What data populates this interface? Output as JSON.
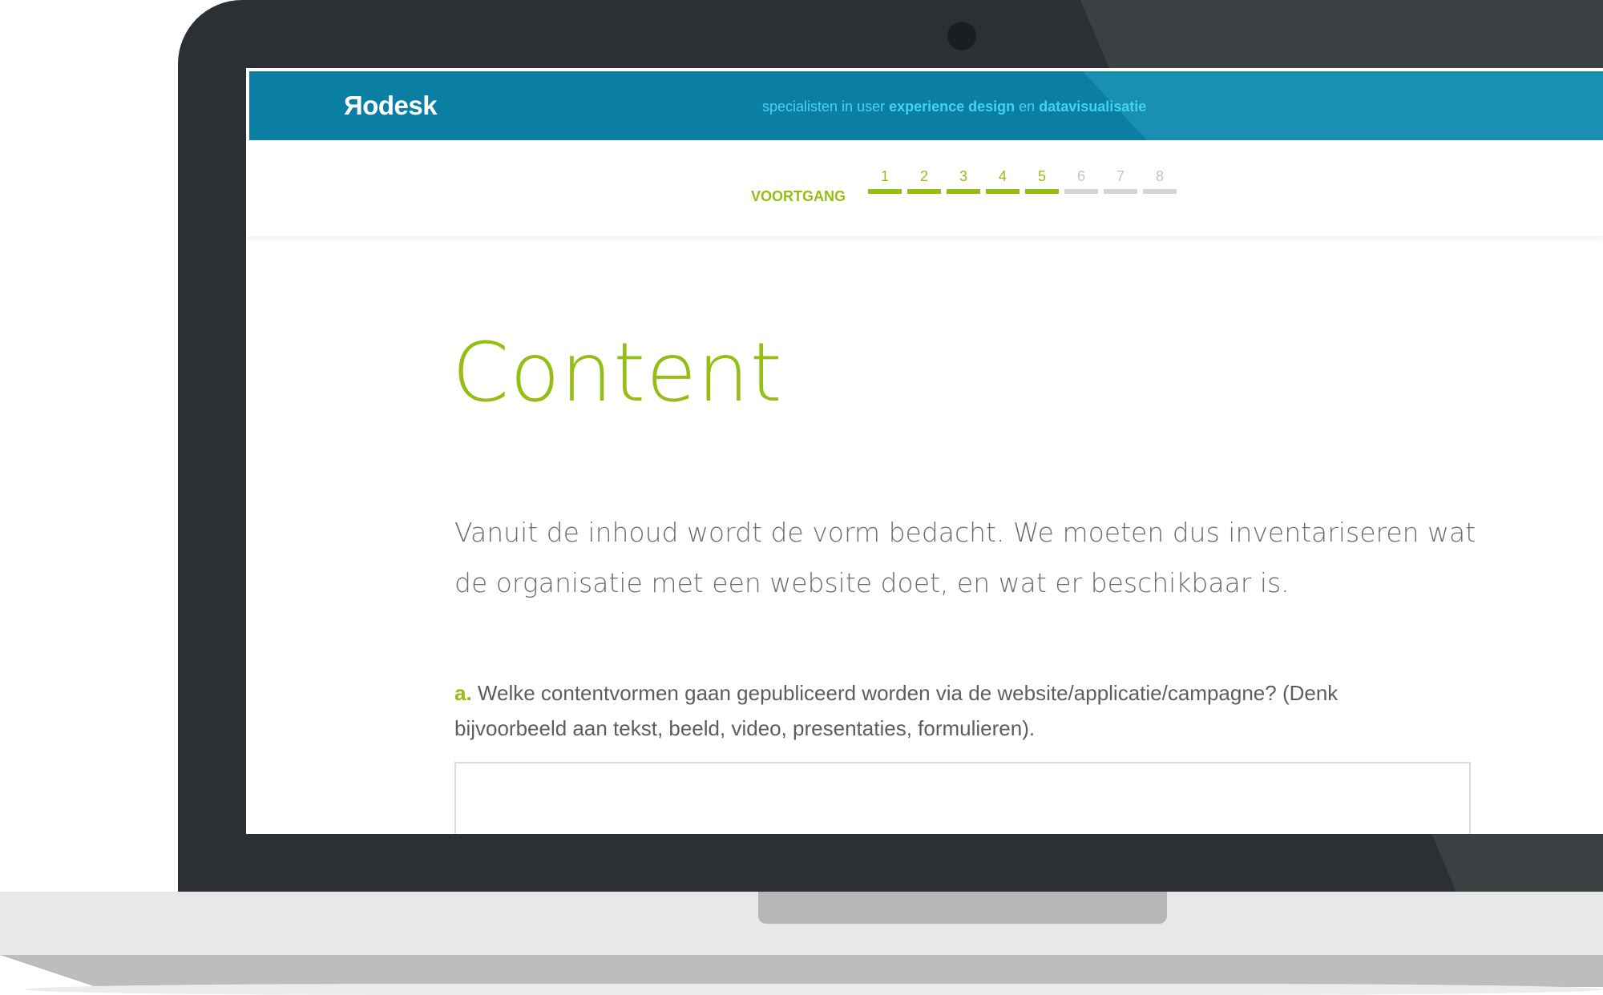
{
  "header": {
    "logo": "Яodesk",
    "tagline_prefix": "specialisten in user ",
    "tagline_strong1": "experience design",
    "tagline_mid": " en ",
    "tagline_strong2": "datavisualisatie"
  },
  "progress": {
    "label": "VOORTGANG",
    "steps": [
      "1",
      "2",
      "3",
      "4",
      "5",
      "6",
      "7",
      "8"
    ],
    "completed": 5,
    "total": 8,
    "accent_color": "#94be14",
    "inactive_color": "#d4d5d6"
  },
  "main": {
    "title": "Content",
    "intro": "Vanuit de inhoud wordt de vorm bedacht. We moeten dus inventariseren wat de organisatie met een website doet, en wat er beschikbaar is.",
    "question": {
      "marker": "a.",
      "text": " Welke contentvormen gaan gepubliceerd worden via de website/applicatie/campagne? (Denk bijvoorbeeld aan tekst, beeld, video, presentaties, formulieren).",
      "answer_value": ""
    }
  },
  "colors": {
    "header_bg": "#0a7fa3",
    "tagline": "#45d2f0",
    "bezel": "#2c3034"
  }
}
